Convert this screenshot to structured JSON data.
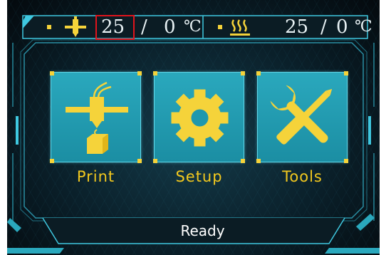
{
  "header": {
    "nozzle": {
      "icon": "nozzle-heater-icon",
      "current": "25",
      "slash": "/",
      "target": "0",
      "unit": "℃"
    },
    "bed": {
      "icon": "heated-bed-icon",
      "current": "25",
      "slash": "/",
      "target": "0",
      "unit": "℃"
    }
  },
  "menu": [
    {
      "label": "Print",
      "icon": "printer-extruder-icon"
    },
    {
      "label": "Setup",
      "icon": "gear-icon"
    },
    {
      "label": "Tools",
      "icon": "wrench-screwdriver-icon"
    }
  ],
  "status": {
    "text": "Ready"
  },
  "colors": {
    "accent": "#f2c81e",
    "tile": "#1f98ad",
    "frame": "#3fc8e0",
    "highlight": "#e0141c"
  }
}
